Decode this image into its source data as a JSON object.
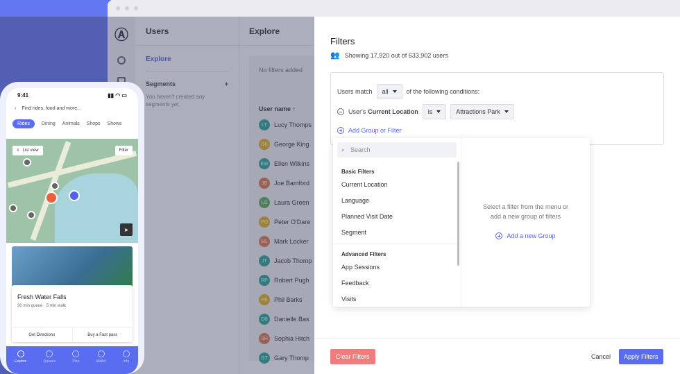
{
  "left_col": {
    "title": "Users",
    "explore": "Explore",
    "segments": "Segments",
    "segments_note": "You haven't created any segments yet."
  },
  "mid_col": {
    "title": "Explore",
    "no_filters": "No filters added",
    "user_name_header": "User name",
    "users": [
      {
        "initials": "LT",
        "name": "Lucy Thomps",
        "color": "#2aa79b"
      },
      {
        "initials": "GK",
        "name": "George King",
        "color": "#e6b422"
      },
      {
        "initials": "EW",
        "name": "Ellen Wilkins",
        "color": "#2aa79b"
      },
      {
        "initials": "JB",
        "name": "Joe Bamford",
        "color": "#e07a4a"
      },
      {
        "initials": "LG",
        "name": "Laura Green",
        "color": "#5bb15b"
      },
      {
        "initials": "PO",
        "name": "Peter O'Dare",
        "color": "#e6b422"
      },
      {
        "initials": "ML",
        "name": "Mark Locker",
        "color": "#e07a4a"
      },
      {
        "initials": "JT",
        "name": "Jacob Thomp",
        "color": "#2aa79b"
      },
      {
        "initials": "RP",
        "name": "Robert Pugh",
        "color": "#2aa79b"
      },
      {
        "initials": "PB",
        "name": "Phil Barks",
        "color": "#e6b422"
      },
      {
        "initials": "DB",
        "name": "Danielle Bas",
        "color": "#2aa79b"
      },
      {
        "initials": "SH",
        "name": "Sophia Hitch",
        "color": "#e07a4a"
      },
      {
        "initials": "GT",
        "name": "Gary Thomp",
        "color": "#2aa79b"
      }
    ]
  },
  "filters": {
    "title": "Filters",
    "showing": "Showing 17,920 out of 633,902 users",
    "users_match": "Users match",
    "match_value": "all",
    "of_following": "of the following conditions:",
    "condition_prefix": "User's",
    "condition_field": "Current Location",
    "condition_op": "is",
    "condition_value": "Attractions Park",
    "add_group": "Add Group or Filter",
    "search_placeholder": "Search",
    "basic_header": "Basic Filters",
    "basic_items": [
      "Current Location",
      "Language",
      "Planned Visit Date",
      "Segment"
    ],
    "advanced_header": "Advanced Filters",
    "advanced_items": [
      "App Sessions",
      "Feedback",
      "Visits"
    ],
    "right_hint_1": "Select a filter from the menu or",
    "right_hint_2": "add a new group of filters",
    "add_new_group": "Add a new Group",
    "clear": "Clear Filters",
    "cancel": "Cancel",
    "apply": "Apply Filters"
  },
  "phone": {
    "time": "9:41",
    "search": "Find rides, food and more...",
    "chips": [
      "Rides",
      "Dining",
      "Animals",
      "Shops",
      "Shows"
    ],
    "list_view": "List view",
    "filter": "Filter",
    "card_title": "Fresh Water Falls",
    "card_sub": "30 min queue · 5 min walk",
    "btn_directions": "Get Directions",
    "btn_fastpass": "Buy a Fast pass",
    "tabs": [
      "Explore",
      "Queues",
      "Plan",
      "Wallet",
      "Info"
    ]
  }
}
